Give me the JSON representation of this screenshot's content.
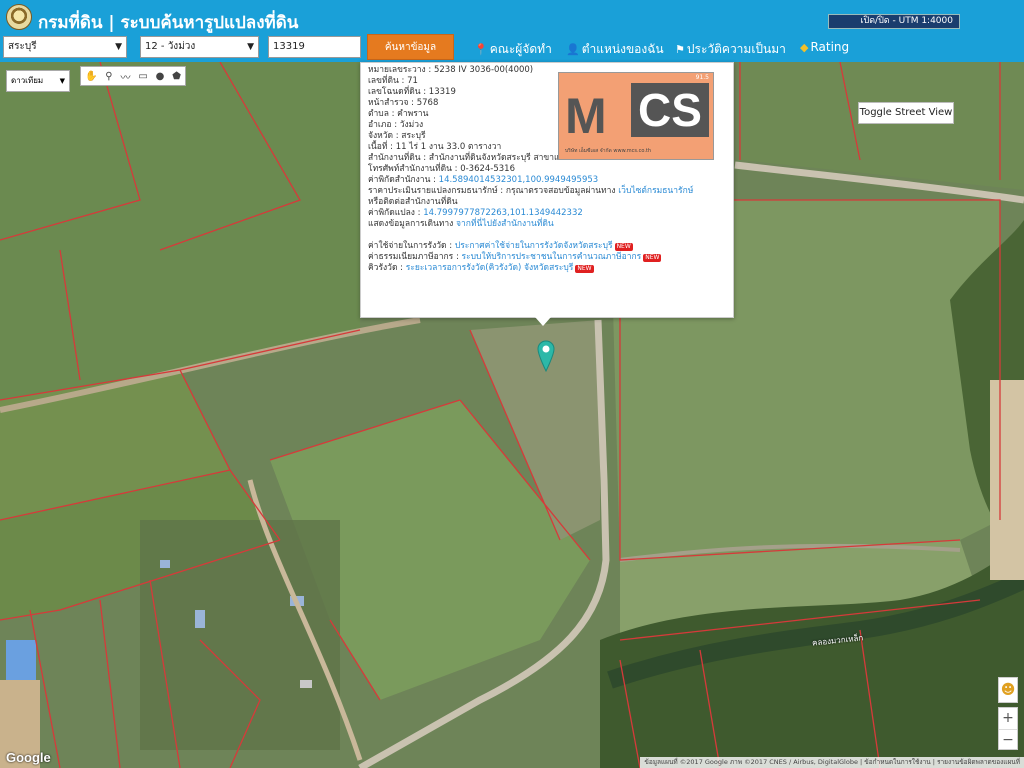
{
  "header": {
    "title": "กรมที่ดิน | ระบบค้นหารูปแปลงที่ดิน",
    "utm_toggle": "เปิด/ปิด - UTM 1:4000",
    "province_select": "สระบุรี",
    "district_select": "12 - วังม่วง",
    "parcel_input": "13319",
    "search_button": "ค้นหาข้อมูล",
    "nav": [
      {
        "label": "คณะผู้จัดทำ",
        "icon": "thumbtack-icon"
      },
      {
        "label": "ตำแหน่งของฉัน",
        "icon": "person-icon"
      },
      {
        "label": "ประวัติความเป็นมา",
        "icon": "flag-icon"
      },
      {
        "label": "Rating",
        "icon": "tag-icon"
      }
    ]
  },
  "map_controls": {
    "map_type": "ดาวเทียม",
    "street_view": "Toggle Street View",
    "draw_tools": [
      "hand-icon",
      "marker-icon",
      "polyline-icon",
      "rectangle-icon",
      "circle-icon",
      "polygon-icon"
    ]
  },
  "popup": {
    "rows": [
      "หมายเลขระวาง : 5238 IV 3036-00(4000)",
      "เลขที่ดิน : 71",
      "เลขโฉนดที่ดิน : 13319",
      "หน้าสำรวจ : 5768",
      "ตำบล : คำพราน",
      "อำเภอ : วังม่วง",
      "จังหวัด : สระบุรี",
      "เนื้อที่ : 11 ไร่ 1 งาน 33.0 ตารางวา",
      "สำนักงานที่ดิน : สำนักงานที่ดินจังหวัดสระบุรี สาขาแก่งคอย",
      "โทรศัพท์สำนักงานที่ดิน : 0-3624-5316"
    ],
    "office_coord_label": "ค่าพิกัดสำนักงาน : ",
    "office_coord": "14.5894014532301,100.9949495953",
    "price_label": "ราคาประเมินรายแปลงกรมธนารักษ์ : กรุณาตรวจสอบข้อมูลผ่านทาง ",
    "price_link": "เว็บไซต์กรมธนารักษ์",
    "price_line2": "หรือติดต่อสำนักงานที่ดิน",
    "parcel_coord_label": "ค่าพิกัดแปลง : ",
    "parcel_coord": "14.7997977872263,101.1349442332",
    "route_label": "แสดงข้อมูลการเดินทาง ",
    "route_link": "จากที่นี่ไปยังสำนักงานที่ดิน",
    "fees": [
      {
        "label": "ค่าใช้จ่ายในการรังวัด : ",
        "link": "ประกาศค่าใช้จ่ายในการรังวัดจังหวัดสระบุรี",
        "badge": "NEW"
      },
      {
        "label": "ค่าธรรมเนียมภาษีอากร : ",
        "link": "ระบบให้บริการประชาชนในการคำนวณภาษีอากร",
        "badge": "NEW"
      },
      {
        "label": "คิวรังวัด : ",
        "link": "ระยะเวลารอการรังวัด(คิวรังวัด) จังหวัดสระบุรี",
        "badge": "NEW"
      }
    ]
  },
  "ad_logo": {
    "text_m": "M",
    "text_cs": "CS",
    "version": "91.5",
    "tagline": "บริษัท เอ็มซีเอส จำกัด www.mcs.co.th"
  },
  "map_labels": {
    "stream": "คลองมวกเหล็ก"
  },
  "footer": {
    "google": "Google",
    "attribution": "ข้อมูลแผนที่ ©2017 Google ภาพ ©2017 CNES / Airbus, DigitalGlobe  |  ข้อกำหนดในการใช้งาน  |  รายงานข้อผิดพลาดของแผนที่"
  }
}
